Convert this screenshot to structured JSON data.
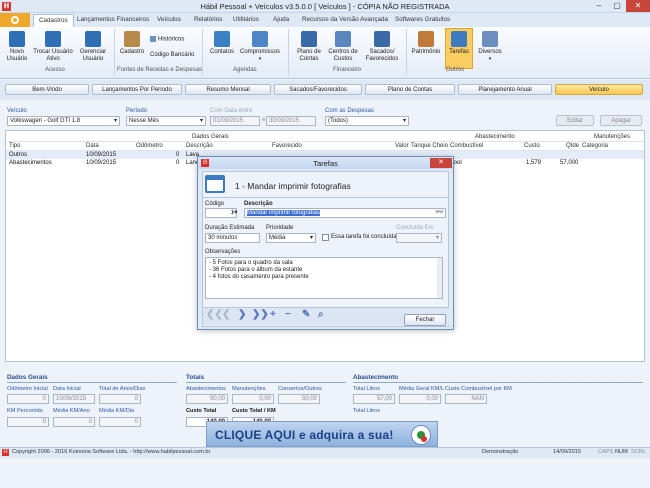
{
  "window": {
    "title": "Hábil Pessoal + Veículos v3.5.0.0 [ Veículos ] - CÓPIA NÃO REGISTRADA",
    "min": "–",
    "max": "▢",
    "close": "✕"
  },
  "ribbon_tabs": [
    "Cadastros",
    "Lançamentos Financeiros",
    "Veículos",
    "Relatórios",
    "Utilitários",
    "Ajuda",
    "Recursos da Versão Avançada",
    "Softwares Gratuitos"
  ],
  "ribbon": {
    "acesso": {
      "label": "Acesso",
      "novo": "Novo Usuário",
      "trocar": "Trocar Usuário Ativo",
      "gerenciar": "Gerenciar Usuário"
    },
    "fontes": {
      "label": "Fontes de Receitas e Despesas",
      "cadastro": "Cadastro",
      "historicos": "Históricos",
      "codigo": "Código Bancário"
    },
    "agendas": {
      "label": "Agendas",
      "contatos": "Contatos",
      "compromissos": "Compromissos"
    },
    "financeiro": {
      "label": "Financeiro",
      "plano": "Plano de Contas",
      "centros": "Centros de Custos",
      "sacados": "Sacados/ Favorecidos"
    },
    "outros": {
      "label": "Outros",
      "patrimonio": "Patrimônio",
      "tarefas": "Tarefas",
      "diversos": "Diversos"
    }
  },
  "nav_tabs": [
    "Bem-Vindo",
    "Lançamentos Por Período",
    "Resumo Mensal",
    "Sacados/Favorecidos",
    "Plano de Contas",
    "Planejamento Anual",
    "Veículo"
  ],
  "filters": {
    "veiculo_label": "Veículo",
    "veiculo_value": "Volkswagen - Golf GTI 1.8",
    "periodo_label": "Período",
    "periodo_value": "Nesse Mês",
    "data_label": "Com Data entre",
    "data_from": "01/09/2015",
    "data_sep": "e",
    "data_to": "30/09/2015",
    "despesas_label": "Com as Despesas",
    "despesas_value": "(Todos)",
    "editar": "Editar",
    "apagar": "Apagar"
  },
  "grid": {
    "group_gerais": "Dados Gerais",
    "group_abast": "Abastecimento",
    "group_manut": "Manutenções",
    "headers": [
      "Tipo",
      "Data",
      "Odômetro",
      "Descrição",
      "Favorecido",
      "Valor",
      "Tanque Cheio",
      "Combustível",
      "Custo",
      "Qtde",
      "Categoria"
    ],
    "rows": [
      {
        "tipo": "Outros",
        "data": "10/09/2015",
        "odometro": "0",
        "descricao": "Lava",
        "valor": "",
        "combustivel": "",
        "custo": "",
        "qtde": ""
      },
      {
        "tipo": "Abastecimentos",
        "data": "10/09/2015",
        "odometro": "0",
        "descricao": "Lanç",
        "valor": "",
        "combustivel": "tool",
        "custo": "1,579",
        "qtde": "57,000"
      }
    ]
  },
  "dialog": {
    "title": "Tarefas",
    "heading": "1 - Mandar imprimir fotografias",
    "codigo_label": "Código",
    "codigo_value": "1",
    "descricao_label": "Descrição",
    "descricao_value": "Mandar imprimir fotografias",
    "duracao_label": "Duração Estimada",
    "duracao_value": "30 minutos",
    "prioridade_label": "Prioridade",
    "prioridade_value": "Média",
    "concluida_label": "Essa tarefa foi concluída",
    "concluida_em_label": "Concluída Em",
    "obs_label": "Observações",
    "obs_lines": [
      "- 5 Fotos para o quadro da sala",
      "- 36 Fotos para o álbum da estante",
      "- 4 fotos do casamento para presente"
    ],
    "fechar": "Fechar"
  },
  "summary": {
    "gerais_title": "Dados Gerais",
    "odometro_inicial_label": "Odômetro Inicial",
    "odometro_inicial": "0",
    "data_inicial_label": "Data Inicial",
    "data_inicial": "10/09/2015",
    "total_anos_label": "Total de Anos/Dias",
    "total_anos": "0",
    "km_percorrido_label": "KM Percorrido",
    "km_percorrido": "0",
    "media_ano_label": "Média KM/Ano",
    "media_ano": "0",
    "media_dia_label": "Média KM/Dia",
    "media_dia": "0",
    "totais_title": "Totais",
    "abastecimentos_label": "Abastecimentos",
    "abastecimentos": "90,00",
    "manutencoes_label": "Manutenções",
    "manutencoes": "0,00",
    "consertos_label": "Consertos/Outros",
    "consertos": "50,00",
    "custo_total_label": "Custo Total",
    "custo_total": "140,00",
    "custo_km_label": "Custo Total / KM",
    "custo_km": "140,00",
    "abast_title": "Abastecimento",
    "total_litros_label": "Total Litros",
    "total_litros": "57,00",
    "media_geral_label": "Média Geral KM/L",
    "media_geral": "0,00",
    "custo_comb_label": "Custo Combustível por KM",
    "custo_comb": "NAN",
    "total_litros2_label": "Total Litros"
  },
  "banner": "CLIQUE AQUI e adquira a sua!",
  "status": {
    "copyright": "Copyright 2006 - 2016 Koinonia Software Ltda. - http://www.habilpessoal.com.br",
    "mode": "Demonstração",
    "date": "14/09/2015",
    "caps": "CAPS",
    "num": "NUM",
    "scrl": "SCRL"
  },
  "colors": {
    "accent": "#f8c84c",
    "title_bar": "#dfe9f5",
    "selection": "#3a6fd0",
    "brand_red": "#d9322b"
  }
}
